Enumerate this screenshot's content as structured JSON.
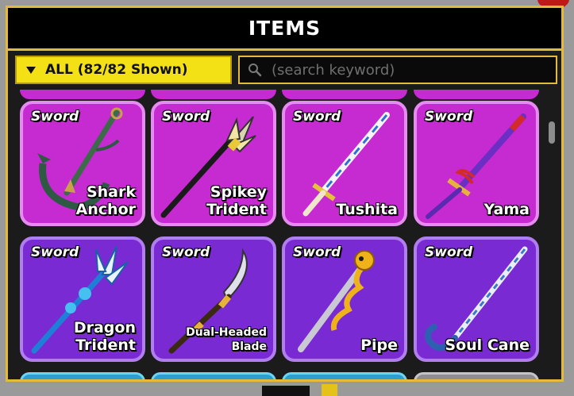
{
  "window": {
    "title": "ITEMS"
  },
  "filter": {
    "label": "ALL (82/82 Shown)"
  },
  "search": {
    "placeholder": "(search keyword)",
    "value": ""
  },
  "items": [
    {
      "type": "Sword",
      "name": "Shark\nAnchor",
      "rarity": "legendary"
    },
    {
      "type": "Sword",
      "name": "Spikey\nTrident",
      "rarity": "legendary"
    },
    {
      "type": "Sword",
      "name": "Tushita",
      "rarity": "legendary"
    },
    {
      "type": "Sword",
      "name": "Yama",
      "rarity": "legendary"
    },
    {
      "type": "Sword",
      "name": "Dragon\nTrident",
      "rarity": "mythical"
    },
    {
      "type": "Sword",
      "name": "Dual-Headed\nBlade",
      "rarity": "mythical"
    },
    {
      "type": "Sword",
      "name": "Pipe",
      "rarity": "mythical"
    },
    {
      "type": "Sword",
      "name": "Soul Cane",
      "rarity": "mythical"
    }
  ],
  "colors": {
    "legendary": "#c52bd0",
    "mythical": "#7a2ad2",
    "accent_gold": "#e3bb38",
    "filter_yellow": "#f3e116"
  }
}
